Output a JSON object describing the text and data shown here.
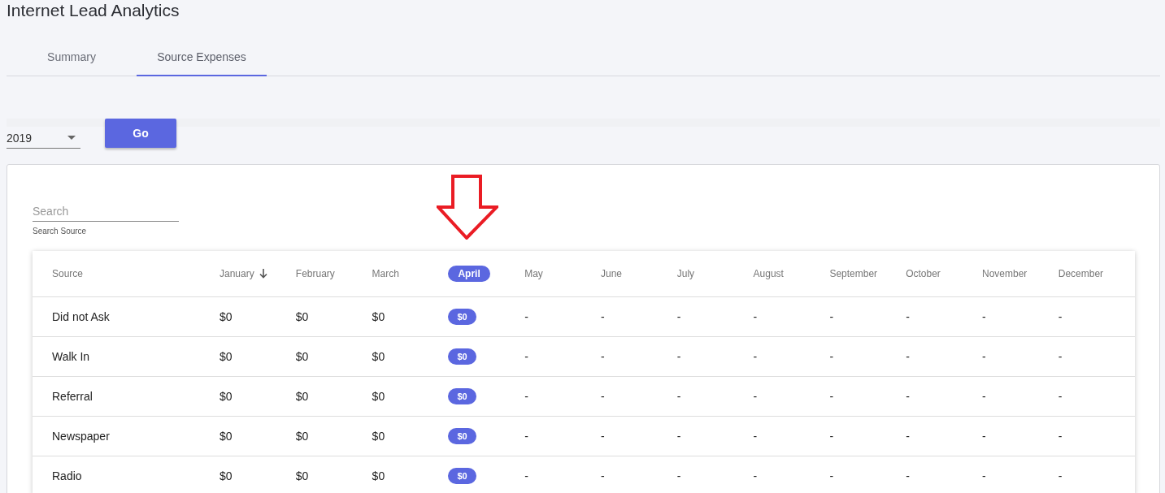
{
  "title": "Internet Lead Analytics",
  "tabs": [
    {
      "label": "Summary",
      "selected": false
    },
    {
      "label": "Source Expenses",
      "selected": true
    }
  ],
  "year_select": {
    "value": "2019"
  },
  "go_button": "Go",
  "search": {
    "placeholder": "Search",
    "helper": "Search Source"
  },
  "table": {
    "columns": [
      {
        "label": "Source",
        "sorted": false,
        "highlighted": false
      },
      {
        "label": "January",
        "sorted": true,
        "highlighted": false
      },
      {
        "label": "February",
        "sorted": false,
        "highlighted": false
      },
      {
        "label": "March",
        "sorted": false,
        "highlighted": false
      },
      {
        "label": "April",
        "sorted": false,
        "highlighted": true
      },
      {
        "label": "May",
        "sorted": false,
        "highlighted": false
      },
      {
        "label": "June",
        "sorted": false,
        "highlighted": false
      },
      {
        "label": "July",
        "sorted": false,
        "highlighted": false
      },
      {
        "label": "August",
        "sorted": false,
        "highlighted": false
      },
      {
        "label": "September",
        "sorted": false,
        "highlighted": false
      },
      {
        "label": "October",
        "sorted": false,
        "highlighted": false
      },
      {
        "label": "November",
        "sorted": false,
        "highlighted": false
      },
      {
        "label": "December",
        "sorted": false,
        "highlighted": false
      }
    ],
    "rows": [
      [
        "Did not Ask",
        "$0",
        "$0",
        "$0",
        "$0",
        "-",
        "-",
        "-",
        "-",
        "-",
        "-",
        "-",
        "-"
      ],
      [
        "Walk In",
        "$0",
        "$0",
        "$0",
        "$0",
        "-",
        "-",
        "-",
        "-",
        "-",
        "-",
        "-",
        "-"
      ],
      [
        "Referral",
        "$0",
        "$0",
        "$0",
        "$0",
        "-",
        "-",
        "-",
        "-",
        "-",
        "-",
        "-",
        "-"
      ],
      [
        "Newspaper",
        "$0",
        "$0",
        "$0",
        "$0",
        "-",
        "-",
        "-",
        "-",
        "-",
        "-",
        "-",
        "-"
      ],
      [
        "Radio",
        "$0",
        "$0",
        "$0",
        "$0",
        "-",
        "-",
        "-",
        "-",
        "-",
        "-",
        "-",
        "-"
      ]
    ]
  }
}
